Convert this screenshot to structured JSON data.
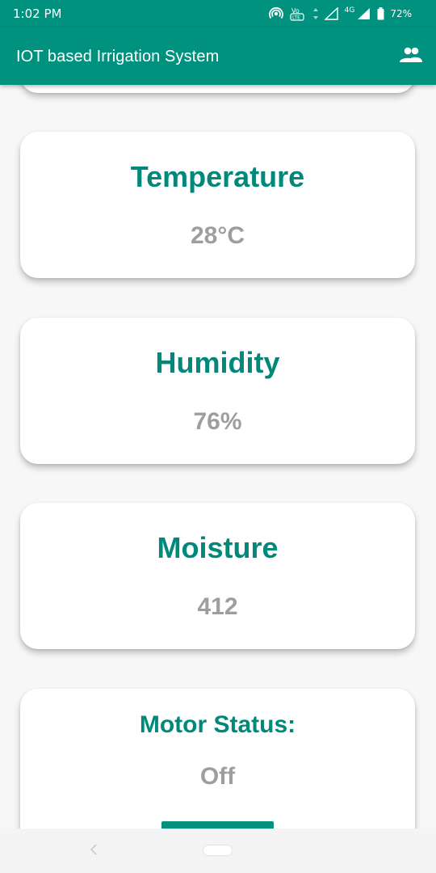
{
  "status_bar": {
    "time": "1:02 PM",
    "network": "4G",
    "battery": "72%",
    "icons": [
      "hotspot-icon",
      "volte-icon",
      "data-arrows-icon",
      "signal-icon",
      "battery-icon"
    ]
  },
  "app_bar": {
    "title": "IOT based Irrigation System",
    "action_icon": "people-icon"
  },
  "cards": {
    "temperature": {
      "title": "Temperature",
      "value": "28°C"
    },
    "humidity": {
      "title": "Humidity",
      "value": "76%"
    },
    "moisture": {
      "title": "Moisture",
      "value": "412"
    },
    "motor": {
      "title": "Motor Status:",
      "value": "Off",
      "button_label": ""
    }
  },
  "colors": {
    "primary": "#00917f",
    "title_text": "#00897b",
    "value_text": "#9e9e9e",
    "background": "#f7f7f7",
    "card": "#ffffff"
  },
  "nav_bar": {
    "icons": [
      "back-icon",
      "home-pill-icon"
    ]
  }
}
